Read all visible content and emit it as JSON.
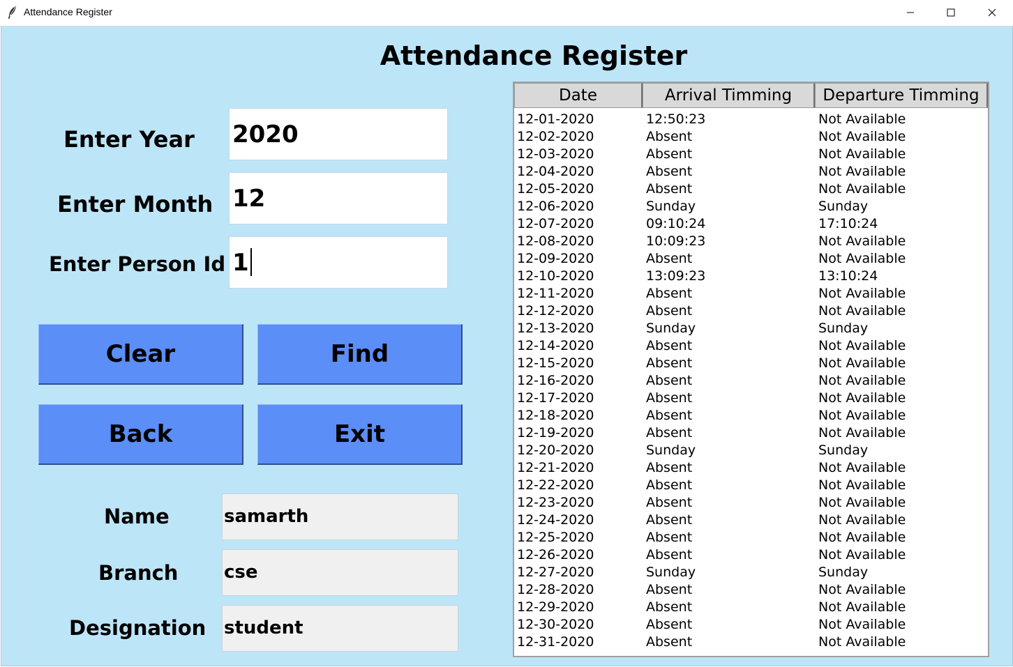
{
  "window": {
    "title": "Attendance Register",
    "controls": [
      "minimize",
      "maximize",
      "close"
    ]
  },
  "page": {
    "heading": "Attendance Register"
  },
  "form": {
    "year_label": "Enter Year",
    "year_value": "2020",
    "month_label": "Enter Month",
    "month_value": "12",
    "person_label": "Enter Person Id",
    "person_value": "1"
  },
  "buttons": {
    "clear": "Clear",
    "find": "Find",
    "back": "Back",
    "exit": "Exit"
  },
  "info": {
    "name_label": "Name",
    "name_value": "samarth",
    "branch_label": "Branch",
    "branch_value": "cse",
    "designation_label": "Designation",
    "designation_value": "student"
  },
  "table": {
    "columns": [
      "Date",
      "Arrival Timming",
      "Departure Timming"
    ],
    "rows": [
      [
        "12-01-2020",
        "12:50:23",
        "Not Available"
      ],
      [
        "12-02-2020",
        "Absent",
        "Not Available"
      ],
      [
        "12-03-2020",
        "Absent",
        "Not Available"
      ],
      [
        "12-04-2020",
        "Absent",
        "Not Available"
      ],
      [
        "12-05-2020",
        "Absent",
        "Not Available"
      ],
      [
        "12-06-2020",
        "Sunday",
        "Sunday"
      ],
      [
        "12-07-2020",
        "09:10:24",
        "17:10:24"
      ],
      [
        "12-08-2020",
        "10:09:23",
        "Not Available"
      ],
      [
        "12-09-2020",
        "Absent",
        "Not Available"
      ],
      [
        "12-10-2020",
        "13:09:23",
        "13:10:24"
      ],
      [
        "12-11-2020",
        "Absent",
        "Not Available"
      ],
      [
        "12-12-2020",
        "Absent",
        "Not Available"
      ],
      [
        "12-13-2020",
        "Sunday",
        "Sunday"
      ],
      [
        "12-14-2020",
        "Absent",
        "Not Available"
      ],
      [
        "12-15-2020",
        "Absent",
        "Not Available"
      ],
      [
        "12-16-2020",
        "Absent",
        "Not Available"
      ],
      [
        "12-17-2020",
        "Absent",
        "Not Available"
      ],
      [
        "12-18-2020",
        "Absent",
        "Not Available"
      ],
      [
        "12-19-2020",
        "Absent",
        "Not Available"
      ],
      [
        "12-20-2020",
        "Sunday",
        "Sunday"
      ],
      [
        "12-21-2020",
        "Absent",
        "Not Available"
      ],
      [
        "12-22-2020",
        "Absent",
        "Not Available"
      ],
      [
        "12-23-2020",
        "Absent",
        "Not Available"
      ],
      [
        "12-24-2020",
        "Absent",
        "Not Available"
      ],
      [
        "12-25-2020",
        "Absent",
        "Not Available"
      ],
      [
        "12-26-2020",
        "Absent",
        "Not Available"
      ],
      [
        "12-27-2020",
        "Sunday",
        "Sunday"
      ],
      [
        "12-28-2020",
        "Absent",
        "Not Available"
      ],
      [
        "12-29-2020",
        "Absent",
        "Not Available"
      ],
      [
        "12-30-2020",
        "Absent",
        "Not Available"
      ],
      [
        "12-31-2020",
        "Absent",
        "Not Available"
      ]
    ]
  },
  "colors": {
    "background": "#bde5f8",
    "button": "#5b8ef6",
    "readonly_field": "#f0f0f0",
    "header_cell": "#d9d9d9"
  }
}
